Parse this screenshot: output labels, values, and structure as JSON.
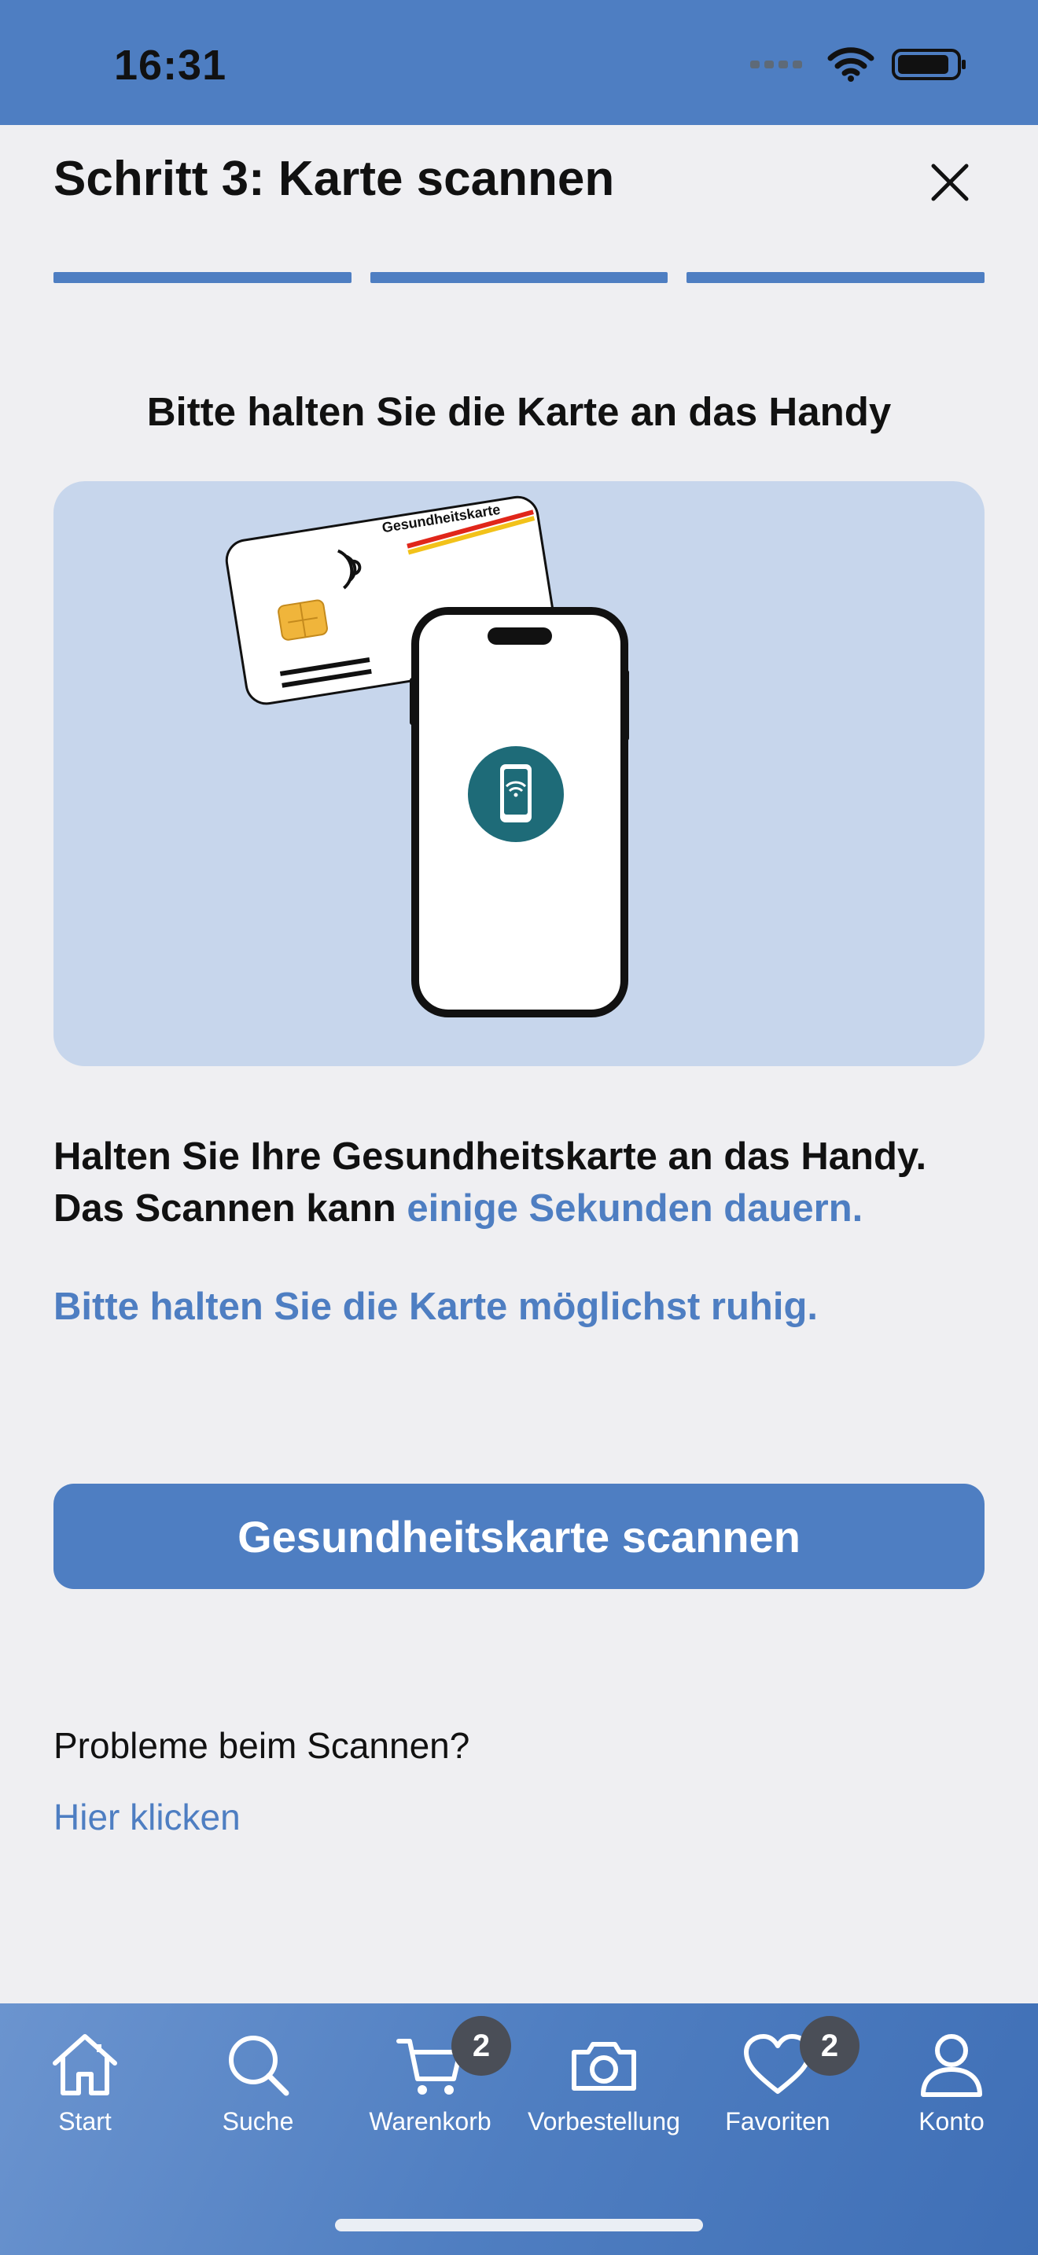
{
  "status_bar": {
    "time": "16:31"
  },
  "header": {
    "title": "Schritt 3: Karte scannen",
    "progress_steps_total": 3,
    "progress_steps_done": 3
  },
  "instruction": "Bitte halten Sie die Karte an das Handy",
  "illustration": {
    "card_label": "Gesundheitskarte"
  },
  "body": {
    "line1": "Halten Sie Ihre Gesundheitskarte an das Handy.",
    "line2_plain": "Das Scannen kann ",
    "line2_highlight": "einige Sekunden dauern.",
    "hint": "Bitte halten Sie die Karte möglichst ruhig."
  },
  "primary_button": "Gesundheitskarte scannen",
  "help": {
    "question": "Probleme beim Scannen?",
    "link": "Hier klicken"
  },
  "tab_bar": {
    "tabs": [
      {
        "label": "Start",
        "icon": "home-icon"
      },
      {
        "label": "Suche",
        "icon": "search-icon"
      },
      {
        "label": "Warenkorb",
        "icon": "cart-icon",
        "badge": "2"
      },
      {
        "label": "Vorbestellung",
        "icon": "camera-icon"
      },
      {
        "label": "Favoriten",
        "icon": "heart-icon",
        "badge": "2"
      },
      {
        "label": "Konto",
        "icon": "user-icon"
      }
    ]
  },
  "colors": {
    "accent": "#4e7ec2",
    "background": "#efeff2",
    "illustration_bg": "#c7d6ec",
    "nfc_circle": "#1e6b78"
  }
}
